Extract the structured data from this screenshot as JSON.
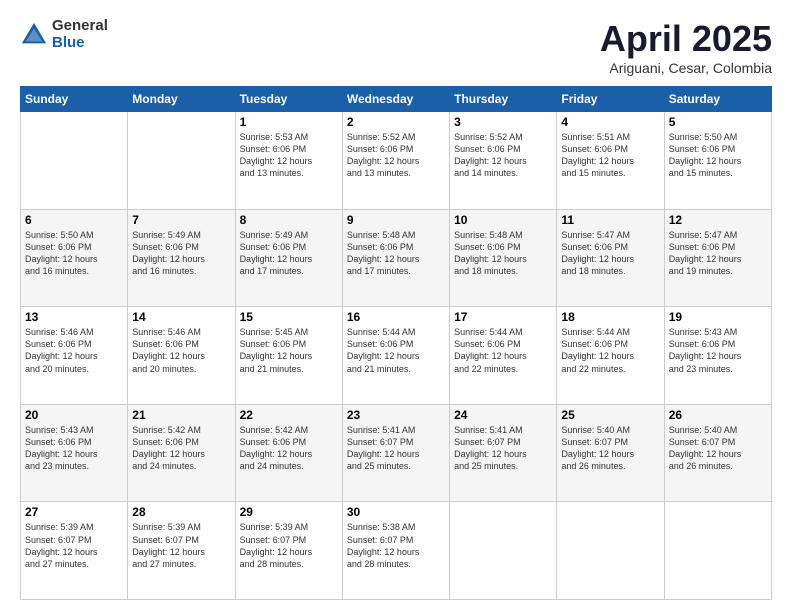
{
  "logo": {
    "general": "General",
    "blue": "Blue"
  },
  "title": "April 2025",
  "subtitle": "Ariguani, Cesar, Colombia",
  "days_header": [
    "Sunday",
    "Monday",
    "Tuesday",
    "Wednesday",
    "Thursday",
    "Friday",
    "Saturday"
  ],
  "weeks": [
    [
      {
        "day": "",
        "info": ""
      },
      {
        "day": "",
        "info": ""
      },
      {
        "day": "1",
        "info": "Sunrise: 5:53 AM\nSunset: 6:06 PM\nDaylight: 12 hours\nand 13 minutes."
      },
      {
        "day": "2",
        "info": "Sunrise: 5:52 AM\nSunset: 6:06 PM\nDaylight: 12 hours\nand 13 minutes."
      },
      {
        "day": "3",
        "info": "Sunrise: 5:52 AM\nSunset: 6:06 PM\nDaylight: 12 hours\nand 14 minutes."
      },
      {
        "day": "4",
        "info": "Sunrise: 5:51 AM\nSunset: 6:06 PM\nDaylight: 12 hours\nand 15 minutes."
      },
      {
        "day": "5",
        "info": "Sunrise: 5:50 AM\nSunset: 6:06 PM\nDaylight: 12 hours\nand 15 minutes."
      }
    ],
    [
      {
        "day": "6",
        "info": "Sunrise: 5:50 AM\nSunset: 6:06 PM\nDaylight: 12 hours\nand 16 minutes."
      },
      {
        "day": "7",
        "info": "Sunrise: 5:49 AM\nSunset: 6:06 PM\nDaylight: 12 hours\nand 16 minutes."
      },
      {
        "day": "8",
        "info": "Sunrise: 5:49 AM\nSunset: 6:06 PM\nDaylight: 12 hours\nand 17 minutes."
      },
      {
        "day": "9",
        "info": "Sunrise: 5:48 AM\nSunset: 6:06 PM\nDaylight: 12 hours\nand 17 minutes."
      },
      {
        "day": "10",
        "info": "Sunrise: 5:48 AM\nSunset: 6:06 PM\nDaylight: 12 hours\nand 18 minutes."
      },
      {
        "day": "11",
        "info": "Sunrise: 5:47 AM\nSunset: 6:06 PM\nDaylight: 12 hours\nand 18 minutes."
      },
      {
        "day": "12",
        "info": "Sunrise: 5:47 AM\nSunset: 6:06 PM\nDaylight: 12 hours\nand 19 minutes."
      }
    ],
    [
      {
        "day": "13",
        "info": "Sunrise: 5:46 AM\nSunset: 6:06 PM\nDaylight: 12 hours\nand 20 minutes."
      },
      {
        "day": "14",
        "info": "Sunrise: 5:46 AM\nSunset: 6:06 PM\nDaylight: 12 hours\nand 20 minutes."
      },
      {
        "day": "15",
        "info": "Sunrise: 5:45 AM\nSunset: 6:06 PM\nDaylight: 12 hours\nand 21 minutes."
      },
      {
        "day": "16",
        "info": "Sunrise: 5:44 AM\nSunset: 6:06 PM\nDaylight: 12 hours\nand 21 minutes."
      },
      {
        "day": "17",
        "info": "Sunrise: 5:44 AM\nSunset: 6:06 PM\nDaylight: 12 hours\nand 22 minutes."
      },
      {
        "day": "18",
        "info": "Sunrise: 5:44 AM\nSunset: 6:06 PM\nDaylight: 12 hours\nand 22 minutes."
      },
      {
        "day": "19",
        "info": "Sunrise: 5:43 AM\nSunset: 6:06 PM\nDaylight: 12 hours\nand 23 minutes."
      }
    ],
    [
      {
        "day": "20",
        "info": "Sunrise: 5:43 AM\nSunset: 6:06 PM\nDaylight: 12 hours\nand 23 minutes."
      },
      {
        "day": "21",
        "info": "Sunrise: 5:42 AM\nSunset: 6:06 PM\nDaylight: 12 hours\nand 24 minutes."
      },
      {
        "day": "22",
        "info": "Sunrise: 5:42 AM\nSunset: 6:06 PM\nDaylight: 12 hours\nand 24 minutes."
      },
      {
        "day": "23",
        "info": "Sunrise: 5:41 AM\nSunset: 6:07 PM\nDaylight: 12 hours\nand 25 minutes."
      },
      {
        "day": "24",
        "info": "Sunrise: 5:41 AM\nSunset: 6:07 PM\nDaylight: 12 hours\nand 25 minutes."
      },
      {
        "day": "25",
        "info": "Sunrise: 5:40 AM\nSunset: 6:07 PM\nDaylight: 12 hours\nand 26 minutes."
      },
      {
        "day": "26",
        "info": "Sunrise: 5:40 AM\nSunset: 6:07 PM\nDaylight: 12 hours\nand 26 minutes."
      }
    ],
    [
      {
        "day": "27",
        "info": "Sunrise: 5:39 AM\nSunset: 6:07 PM\nDaylight: 12 hours\nand 27 minutes."
      },
      {
        "day": "28",
        "info": "Sunrise: 5:39 AM\nSunset: 6:07 PM\nDaylight: 12 hours\nand 27 minutes."
      },
      {
        "day": "29",
        "info": "Sunrise: 5:39 AM\nSunset: 6:07 PM\nDaylight: 12 hours\nand 28 minutes."
      },
      {
        "day": "30",
        "info": "Sunrise: 5:38 AM\nSunset: 6:07 PM\nDaylight: 12 hours\nand 28 minutes."
      },
      {
        "day": "",
        "info": ""
      },
      {
        "day": "",
        "info": ""
      },
      {
        "day": "",
        "info": ""
      }
    ]
  ]
}
